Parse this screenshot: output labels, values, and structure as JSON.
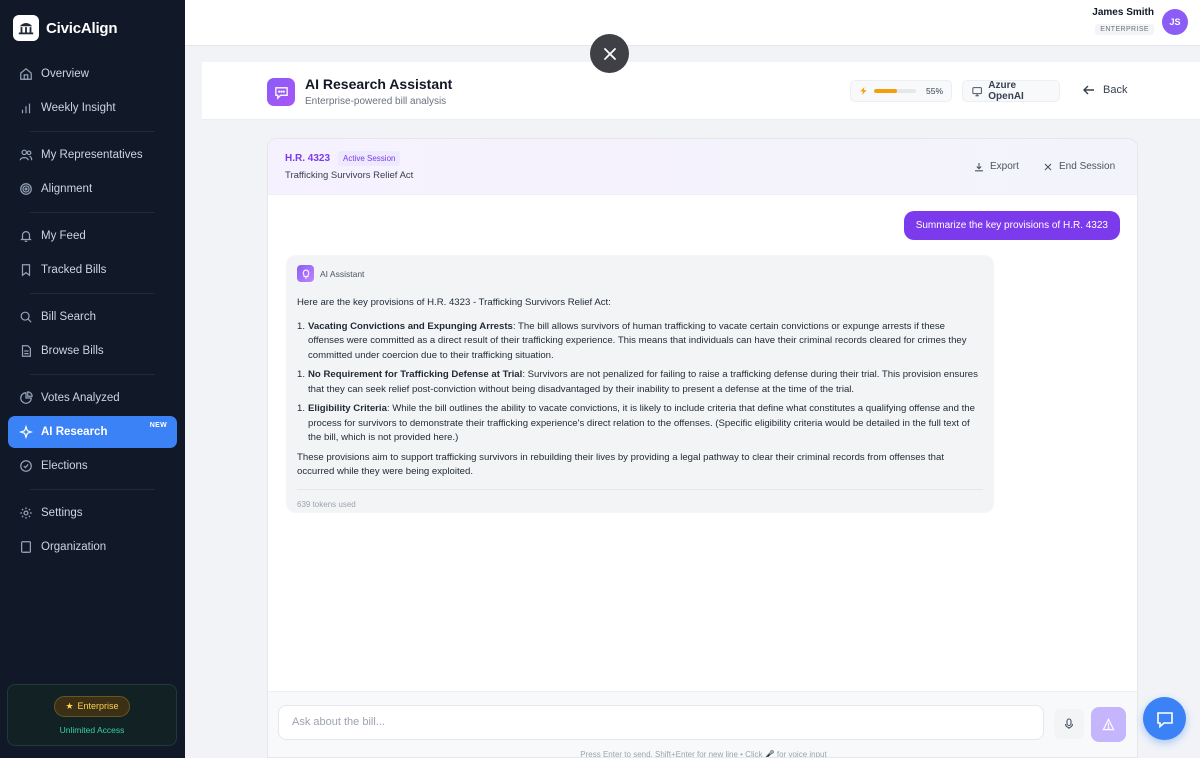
{
  "brand": {
    "name": "CivicAlign",
    "logo_icon": "capitol-logo-icon"
  },
  "sidebar": {
    "items": [
      {
        "label": "Overview",
        "icon": "home-icon"
      },
      {
        "label": "Weekly Insight",
        "icon": "bar-chart-icon"
      },
      {
        "label": "My Representatives",
        "icon": "users-icon"
      },
      {
        "label": "Alignment",
        "icon": "target-icon"
      },
      {
        "label": "My Feed",
        "icon": "bell-icon"
      },
      {
        "label": "Tracked Bills",
        "icon": "bookmark-icon"
      },
      {
        "label": "Bill Search",
        "icon": "search-icon"
      },
      {
        "label": "Browse Bills",
        "icon": "document-icon"
      },
      {
        "label": "Votes Analyzed",
        "icon": "pie-chart-icon"
      },
      {
        "label": "AI Research",
        "icon": "sparkles-icon",
        "badge": "NEW",
        "active": true
      },
      {
        "label": "Elections",
        "icon": "check-circle-icon"
      },
      {
        "label": "Settings",
        "icon": "gear-icon"
      },
      {
        "label": "Organization",
        "icon": "building-icon"
      }
    ],
    "plan": {
      "label": "Enterprise",
      "sub": "Unlimited Access",
      "icon": "star-icon"
    }
  },
  "user": {
    "name": "James Smith",
    "role": "ENTERPRISE",
    "initials": "JS"
  },
  "header": {
    "title": "AI Research Assistant",
    "subtitle": "Enterprise-powered bill analysis",
    "usage_pct": 55,
    "usage_label": "55%",
    "model": "Azure OpenAI",
    "back": "Back"
  },
  "session": {
    "bill_id": "H.R. 4323",
    "status": "Active Session",
    "bill_title": "Trafficking Survivors Relief Act",
    "export": "Export",
    "end": "End Session"
  },
  "chat": {
    "user_message": "Summarize the key provisions of H.R. 4323",
    "assistant_name": "AI Assistant",
    "intro": "Here are the key provisions of H.R. 4323 - Trafficking Survivors Relief Act:",
    "points": [
      {
        "num": "1.",
        "title": "Vacating Convictions and Expunging Arrests",
        "text": ": The bill allows survivors of human trafficking to vacate certain convictions or expunge arrests if these offenses were committed as a direct result of their trafficking experience. This means that individuals can have their criminal records cleared for crimes they committed under coercion due to their trafficking situation."
      },
      {
        "num": "1.",
        "title": "No Requirement for Trafficking Defense at Trial",
        "text": ": Survivors are not penalized for failing to raise a trafficking defense during their trial. This provision ensures that they can seek relief post-conviction without being disadvantaged by their inability to present a defense at the time of the trial."
      },
      {
        "num": "1.",
        "title": "Eligibility Criteria",
        "text": ": While the bill outlines the ability to vacate convictions, it is likely to include criteria that define what constitutes a qualifying offense and the process for survivors to demonstrate their trafficking experience's direct relation to the offenses. (Specific eligibility criteria would be detailed in the full text of the bill, which is not provided here.)"
      }
    ],
    "conclusion": "These provisions aim to support trafficking survivors in rebuilding their lives by providing a legal pathway to clear their criminal records from offenses that occurred while they were being exploited.",
    "tokens": "639 tokens used"
  },
  "composer": {
    "placeholder": "Ask about the bill...",
    "hint": "Press Enter to send, Shift+Enter for new line • Click 🎤 for voice input"
  },
  "colors": {
    "accent": "#7c3aed",
    "sidebar_bg": "#111827",
    "active_nav": "#3b82f6",
    "usage": "#f59e0b"
  }
}
